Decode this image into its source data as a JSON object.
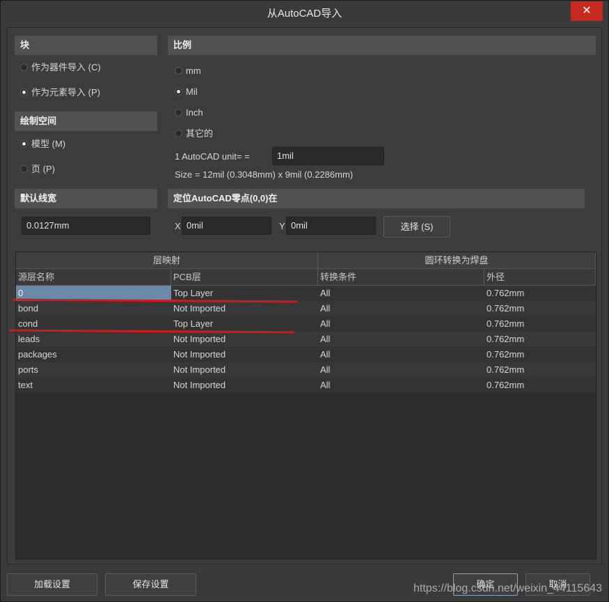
{
  "window": {
    "title": "从AutoCAD导入",
    "close_label": "✕"
  },
  "block": {
    "header": "块",
    "options": [
      {
        "label": "作为器件导入 (C)",
        "checked": false
      },
      {
        "label": "作为元素导入 (P)",
        "checked": true
      }
    ]
  },
  "drawspace": {
    "header": "绘制空间",
    "options": [
      {
        "label": "模型 (M)",
        "checked": true
      },
      {
        "label": "页 (P)",
        "checked": false
      }
    ]
  },
  "linewidth": {
    "header": "默认线宽",
    "value": "0.0127mm"
  },
  "scale": {
    "header": "比例",
    "options": [
      {
        "label": "mm",
        "checked": false
      },
      {
        "label": "Mil",
        "checked": true
      },
      {
        "label": "Inch",
        "checked": false
      },
      {
        "label": "其它的",
        "checked": false
      }
    ],
    "unit_label": "1 AutoCAD unit= =",
    "unit_value": "1mil",
    "size_text": "Size = 12mil (0.3048mm) x 9mil (0.2286mm)"
  },
  "origin": {
    "header": "定位AutoCAD零点(0,0)在",
    "x_label": "X",
    "x_value": "0mil",
    "y_label": "Y",
    "y_value": "0mil",
    "select_label": "选择 (S)"
  },
  "grid": {
    "group_mapping": "层映射",
    "group_pad": "圆环转换为焊盘",
    "columns": [
      "源层名称",
      "PCB层",
      "转换条件",
      "外径"
    ],
    "rows": [
      {
        "source": "0",
        "pcb": "Top Layer",
        "cond": "All",
        "diam": "0.762mm"
      },
      {
        "source": "bond",
        "pcb": "Not Imported",
        "cond": "All",
        "diam": "0.762mm"
      },
      {
        "source": "cond",
        "pcb": "Top Layer",
        "cond": "All",
        "diam": "0.762mm"
      },
      {
        "source": "leads",
        "pcb": "Not Imported",
        "cond": "All",
        "diam": "0.762mm"
      },
      {
        "source": "packages",
        "pcb": "Not Imported",
        "cond": "All",
        "diam": "0.762mm"
      },
      {
        "source": "ports",
        "pcb": "Not Imported",
        "cond": "All",
        "diam": "0.762mm"
      },
      {
        "source": "text",
        "pcb": "Not Imported",
        "cond": "All",
        "diam": "0.762mm"
      }
    ]
  },
  "footer": {
    "load_label": "加载设置",
    "save_label": "保存设置",
    "ok_label": "确定",
    "cancel_label": "取消"
  },
  "watermark": "https://blog.csdn.net/weixin_44115643",
  "colors": {
    "selection": "#6b8aa8",
    "annotation_red": "#d11a1a",
    "close": "#c42b1c"
  }
}
